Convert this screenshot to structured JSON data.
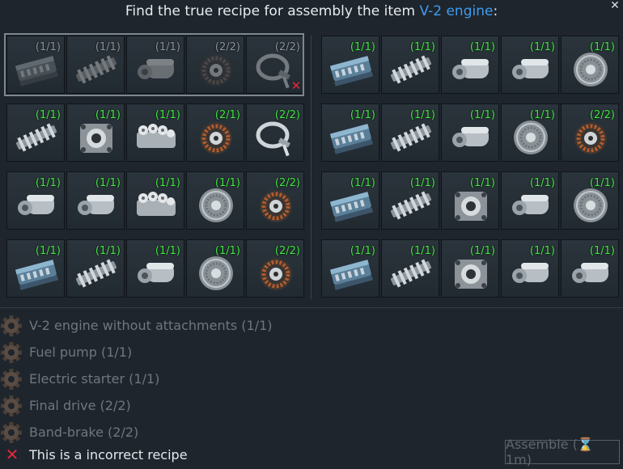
{
  "title": {
    "prefix": "Find the true recipe for assembly the item ",
    "item": "V-2 engine",
    "suffix": ":"
  },
  "close_glyph": "✕",
  "selected_row": [
    {
      "icon": "engine-block-icon",
      "count": "(1/1)"
    },
    {
      "icon": "fuel-pump-icon",
      "count": "(1/1)"
    },
    {
      "icon": "electric-starter-icon",
      "count": "(1/1)"
    },
    {
      "icon": "final-drive-icon",
      "count": "(2/2)"
    },
    {
      "icon": "band-brake-icon",
      "count": "(2/2)"
    }
  ],
  "left_rows": [
    [
      {
        "icon": "fuel-pump-icon",
        "count": "(1/1)"
      },
      {
        "icon": "oil-pump-icon",
        "count": "(1/1)"
      },
      {
        "icon": "injector-pump-icon",
        "count": "(1/1)"
      },
      {
        "icon": "final-drive-icon",
        "count": "(2/1)"
      },
      {
        "icon": "band-brake-icon",
        "count": "(2/2)"
      }
    ],
    [
      {
        "icon": "electric-starter-icon",
        "count": "(1/1)"
      },
      {
        "icon": "electric-starter-icon",
        "count": "(1/1)"
      },
      {
        "icon": "injector-pump-icon",
        "count": "(1/1)"
      },
      {
        "icon": "clutch-disc-icon",
        "count": "(1/1)"
      },
      {
        "icon": "final-drive-icon",
        "count": "(2/2)"
      }
    ],
    [
      {
        "icon": "engine-block-icon",
        "count": "(1/1)"
      },
      {
        "icon": "fuel-pump-icon",
        "count": "(1/1)"
      },
      {
        "icon": "electric-starter-icon",
        "count": "(1/1)"
      },
      {
        "icon": "clutch-disc-icon",
        "count": "(1/1)"
      },
      {
        "icon": "final-drive-icon",
        "count": "(2/2)"
      }
    ]
  ],
  "right_rows": [
    [
      {
        "icon": "engine-block-icon",
        "count": "(1/1)"
      },
      {
        "icon": "fuel-pump-icon",
        "count": "(1/1)"
      },
      {
        "icon": "electric-starter-icon",
        "count": "(1/1)"
      },
      {
        "icon": "electric-starter-icon",
        "count": "(1/1)"
      },
      {
        "icon": "clutch-disc-icon",
        "count": "(1/1)"
      }
    ],
    [
      {
        "icon": "engine-block-icon",
        "count": "(1/1)"
      },
      {
        "icon": "fuel-pump-icon",
        "count": "(1/1)"
      },
      {
        "icon": "electric-starter-icon",
        "count": "(1/1)"
      },
      {
        "icon": "clutch-disc-icon",
        "count": "(1/1)"
      },
      {
        "icon": "final-drive-icon",
        "count": "(2/2)"
      }
    ],
    [
      {
        "icon": "engine-block-icon",
        "count": "(1/1)"
      },
      {
        "icon": "fuel-pump-icon",
        "count": "(1/1)"
      },
      {
        "icon": "oil-pump-icon",
        "count": "(1/1)"
      },
      {
        "icon": "electric-starter-icon",
        "count": "(1/1)"
      },
      {
        "icon": "clutch-disc-icon",
        "count": "(1/1)"
      }
    ],
    [
      {
        "icon": "engine-block-icon",
        "count": "(1/1)"
      },
      {
        "icon": "fuel-pump-icon",
        "count": "(1/1)"
      },
      {
        "icon": "oil-pump-icon",
        "count": "(1/1)"
      },
      {
        "icon": "electric-starter-icon",
        "count": "(1/1)"
      },
      {
        "icon": "electric-starter-icon",
        "count": "(1/1)"
      }
    ]
  ],
  "components": [
    "V-2 engine without attachments (1/1)",
    "Fuel pump (1/1)",
    "Electric starter (1/1)",
    "Final drive (2/2)",
    "Band-brake (2/2)"
  ],
  "status": {
    "icon": "incorrect-x-icon",
    "glyph": "✕",
    "text": "This is a incorrect recipe"
  },
  "assemble": {
    "label": "Assemble (⌛ 1m)"
  },
  "colors": {
    "accent": "#3f9cf0",
    "count_green": "#3ee83e",
    "error_red": "#e2283a"
  }
}
